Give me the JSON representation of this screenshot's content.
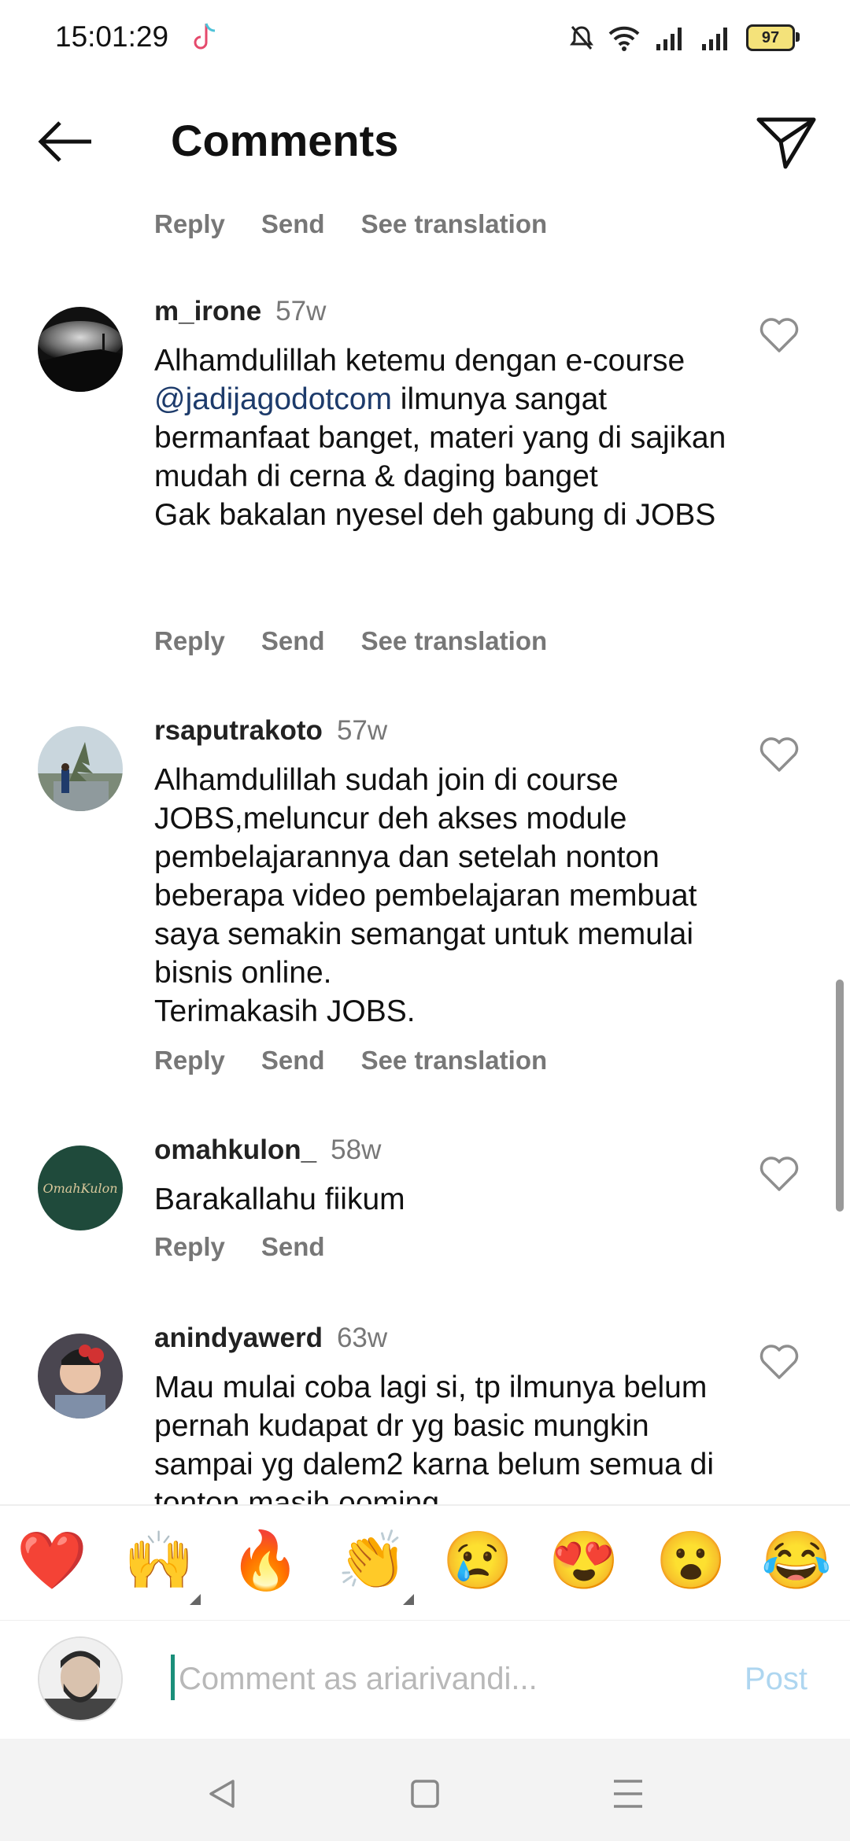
{
  "status_bar": {
    "time": "15:01:29",
    "battery": "97",
    "icons": [
      "tiktok-icon",
      "mute-icon",
      "wifi-icon",
      "signal-icon",
      "signal-icon",
      "battery-icon"
    ]
  },
  "header": {
    "title": "Comments",
    "back_icon": "back-arrow-icon",
    "share_icon": "send-icon"
  },
  "top_actions": {
    "reply": "Reply",
    "send": "Send",
    "translate": "See translation"
  },
  "comments": [
    {
      "username": "m_irone",
      "age": "57w",
      "text_before": "Alhamdulillah ketemu dengan e-course ",
      "mention": "@jadijagodotcom",
      "text_after": " ilmunya sangat bermanfaat banget, materi yang di sajikan mudah di cerna & daging banget\nGak bakalan nyesel deh gabung di JOBS",
      "reply": "Reply",
      "send": "Send",
      "translate": "See translation"
    },
    {
      "username": "rsaputrakoto",
      "age": "57w",
      "text": "Alhamdulillah sudah join di course JOBS,meluncur deh akses module pembelajarannya dan setelah nonton beberapa video pembelajaran membuat saya semakin semangat untuk memulai bisnis online.\nTerimakasih JOBS.",
      "reply": "Reply",
      "send": "Send",
      "translate": "See translation"
    },
    {
      "username": "omahkulon_",
      "age": "58w",
      "avatar_text": "OmahKulon",
      "text": "Barakallahu fiikum",
      "reply": "Reply",
      "send": "Send"
    },
    {
      "username": "anindyawerd",
      "age": "63w",
      "text": "Mau mulai coba lagi si, tp ilmunya belum pernah kudapat dr yg basic mungkin sampai yg dalem2 karna belum semua di tonton masih ooming"
    }
  ],
  "emoji_bar": [
    "❤️",
    "🙌",
    "🔥",
    "👏",
    "😢",
    "😍",
    "😮",
    "😂"
  ],
  "input": {
    "placeholder": "Comment as ariarivandi...",
    "post": "Post"
  },
  "nav": [
    "back-triangle-icon",
    "home-square-icon",
    "menu-lines-icon"
  ],
  "colors": {
    "mention": "#1d3b6b",
    "post_disabled": "#aed6f0",
    "caret": "#1a8f7a"
  }
}
